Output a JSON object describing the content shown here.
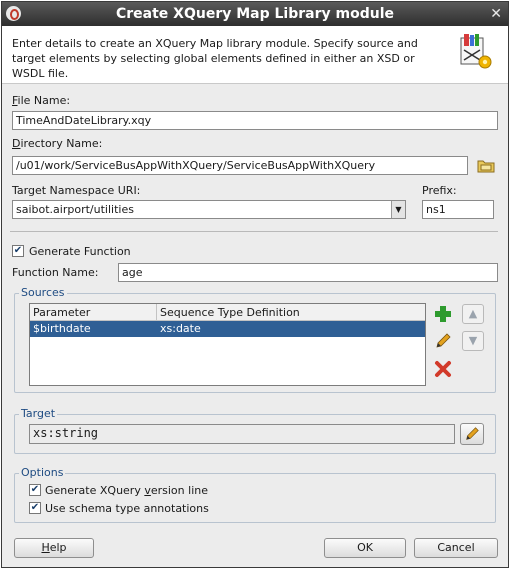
{
  "window": {
    "title": "Create XQuery Map Library module",
    "close_glyph": "✕"
  },
  "header": {
    "description": "Enter details to create an XQuery Map library module. Specify source and target elements by selecting global elements defined in either an XSD or WSDL file.",
    "icon": "xquery-map-wizard-icon"
  },
  "file_name": {
    "label_prefix": "F",
    "label_rest": "ile Name:",
    "value": "TimeAndDateLibrary.xqy"
  },
  "directory": {
    "label_prefix": "D",
    "label_rest": "irectory Name:",
    "value": "/u01/work/ServiceBusAppWithXQuery/ServiceBusAppWithXQuery",
    "browse_icon": "folder-browse-icon"
  },
  "namespace": {
    "label": "Target Namespace URI:",
    "value": "saibot.airport/utilities",
    "dropdown_glyph": "▼"
  },
  "prefix": {
    "label": "Prefix:",
    "value": "ns1"
  },
  "generate_function": {
    "label": "Generate Function",
    "checked": true
  },
  "function_name": {
    "label": "Function Name:",
    "value": "age"
  },
  "sources": {
    "title": "Sources",
    "columns": [
      "Parameter",
      "Sequence Type Definition"
    ],
    "rows": [
      {
        "parameter": "$birthdate",
        "type": "xs:date",
        "selected": true
      }
    ],
    "buttons": {
      "add": "add-icon",
      "edit": "edit-pencil-icon",
      "delete": "delete-icon",
      "up": "▲",
      "down": "▼"
    }
  },
  "target": {
    "title": "Target",
    "value": "xs:string",
    "edit_icon": "edit-pencil-icon"
  },
  "options": {
    "title": "Options",
    "items": [
      {
        "label_pre": "Generate XQuery ",
        "label_ul": "v",
        "label_post": "ersion line",
        "checked": true
      },
      {
        "label_pre": "Use schema type annotations",
        "label_ul": "",
        "label_post": "",
        "checked": true
      }
    ]
  },
  "footer": {
    "help_ul": "H",
    "help_rest": "elp",
    "ok": "OK",
    "cancel": "Cancel"
  },
  "colors": {
    "selection": "#2f5f95",
    "group_title": "#1e4b82",
    "add_green": "#2e9b2e",
    "delete_red": "#d23a2a"
  }
}
